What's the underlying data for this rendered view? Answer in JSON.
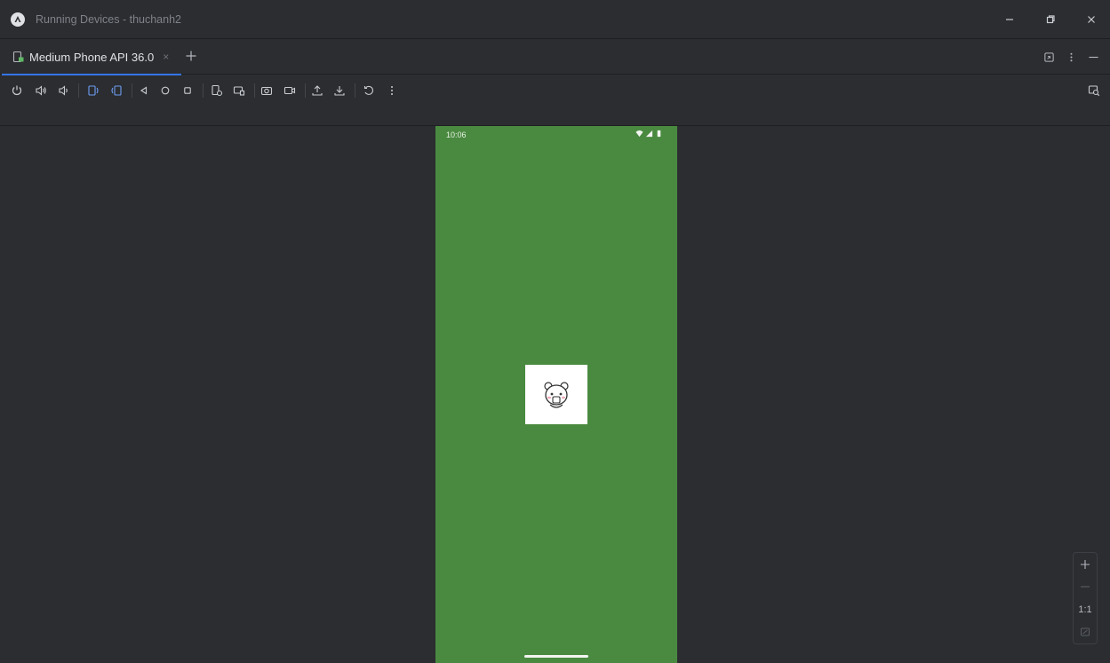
{
  "window": {
    "title": "Running Devices - thuchanh2"
  },
  "tabs": [
    {
      "label": "Medium Phone API 36.0",
      "close_glyph": "×",
      "icon": "device-icon",
      "active": true
    }
  ],
  "tab_add_glyph": "+",
  "toolbar": {
    "icons": [
      "power-icon",
      "volume-up-icon",
      "volume-down-icon",
      "rotate-left-icon",
      "rotate-right-icon",
      "back-icon",
      "home-icon",
      "overview-icon",
      "device-snapshot-icon",
      "device-frame-icon",
      "screenshot-icon",
      "screen-record-icon",
      "upload-icon",
      "download-icon",
      "restore-icon",
      "more-options-icon",
      "layout-inspector-icon"
    ]
  },
  "phone": {
    "status_time": "10:06",
    "background_color": "#4a8a40"
  },
  "zoom": {
    "zoom_in": "+",
    "zoom_out": "−",
    "actual_size": "1:1"
  },
  "colors": {
    "accent": "#3574f0",
    "background": "#2b2d30",
    "phone_green": "#4a8a40"
  }
}
